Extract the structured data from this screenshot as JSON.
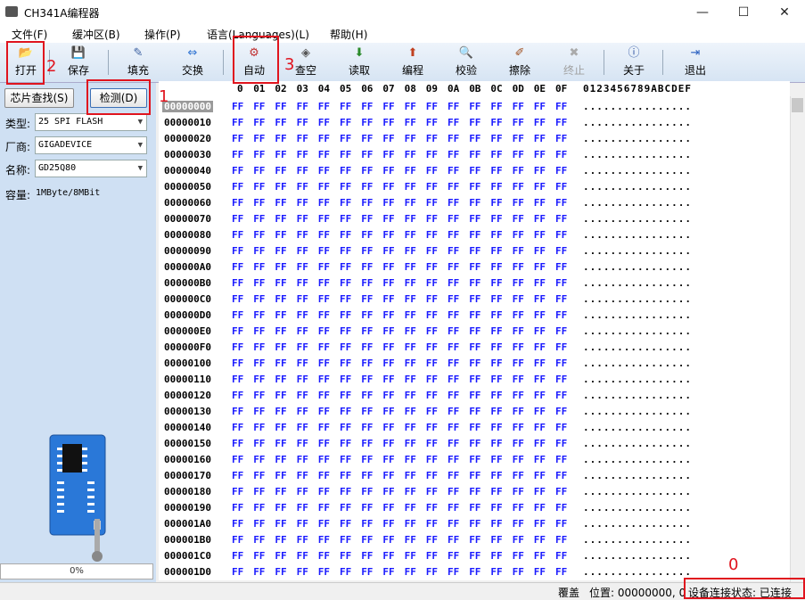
{
  "window": {
    "title": "CH341A编程器",
    "minimize": "—",
    "maximize": "☐",
    "close": "✕"
  },
  "menu": [
    "文件(F)",
    "缓冲区(B)",
    "操作(P)",
    "语言(Languages)(L)",
    "帮助(H)"
  ],
  "toolbar": [
    {
      "label": "打开",
      "icon": "open-folder-icon",
      "glyph": "📂"
    },
    {
      "label": "保存",
      "icon": "save-disk-icon",
      "glyph": "💾"
    },
    {
      "label": "填充",
      "icon": "fill-icon",
      "glyph": "✎"
    },
    {
      "label": "交换",
      "icon": "swap-arrows-icon",
      "glyph": "⇔"
    },
    {
      "label": "自动",
      "icon": "auto-icon",
      "glyph": "⚙"
    },
    {
      "label": "查空",
      "icon": "blank-check-icon",
      "glyph": "◈"
    },
    {
      "label": "读取",
      "icon": "read-icon",
      "glyph": "⬇"
    },
    {
      "label": "编程",
      "icon": "program-icon",
      "glyph": "⬆"
    },
    {
      "label": "校验",
      "icon": "verify-icon",
      "glyph": "🔍"
    },
    {
      "label": "擦除",
      "icon": "erase-icon",
      "glyph": "✐"
    },
    {
      "label": "终止",
      "icon": "stop-icon",
      "glyph": "✖"
    },
    {
      "label": "关于",
      "icon": "info-icon",
      "glyph": "ⓘ"
    },
    {
      "label": "退出",
      "icon": "exit-icon",
      "glyph": "⇥"
    }
  ],
  "left": {
    "search_button": "芯片查找(S)",
    "detect_button": "检测(D)",
    "type_label": "类型:",
    "type_value": "25 SPI FLASH",
    "vendor_label": "厂商:",
    "vendor_value": "GIGADEVICE",
    "name_label": "名称:",
    "name_value": "GD25Q80",
    "capacity_label": "容量:",
    "capacity_value": "1MByte/8MBit",
    "progress": 0,
    "progress_text": "0%"
  },
  "hex": {
    "columns": [
      "0",
      "01",
      "02",
      "03",
      "04",
      "05",
      "06",
      "07",
      "08",
      "09",
      "0A",
      "0B",
      "0C",
      "0D",
      "0E",
      "0F"
    ],
    "ascii_header": "0123456789ABCDEF",
    "rows": [
      "00000000",
      "00000010",
      "00000020",
      "00000030",
      "00000040",
      "00000050",
      "00000060",
      "00000070",
      "00000080",
      "00000090",
      "000000A0",
      "000000B0",
      "000000C0",
      "000000D0",
      "000000E0",
      "000000F0",
      "00000100",
      "00000110",
      "00000120",
      "00000130",
      "00000140",
      "00000150",
      "00000160",
      "00000170",
      "00000180",
      "00000190",
      "000001A0",
      "000001B0",
      "000001C0",
      "000001D0"
    ],
    "byte": "FF",
    "ascii": "................"
  },
  "status": {
    "mode": "覆盖",
    "position": "位置: 00000000, 0",
    "connection": "设备连接状态: 已连接"
  },
  "annotations": [
    "1",
    "2",
    "3",
    "0"
  ]
}
